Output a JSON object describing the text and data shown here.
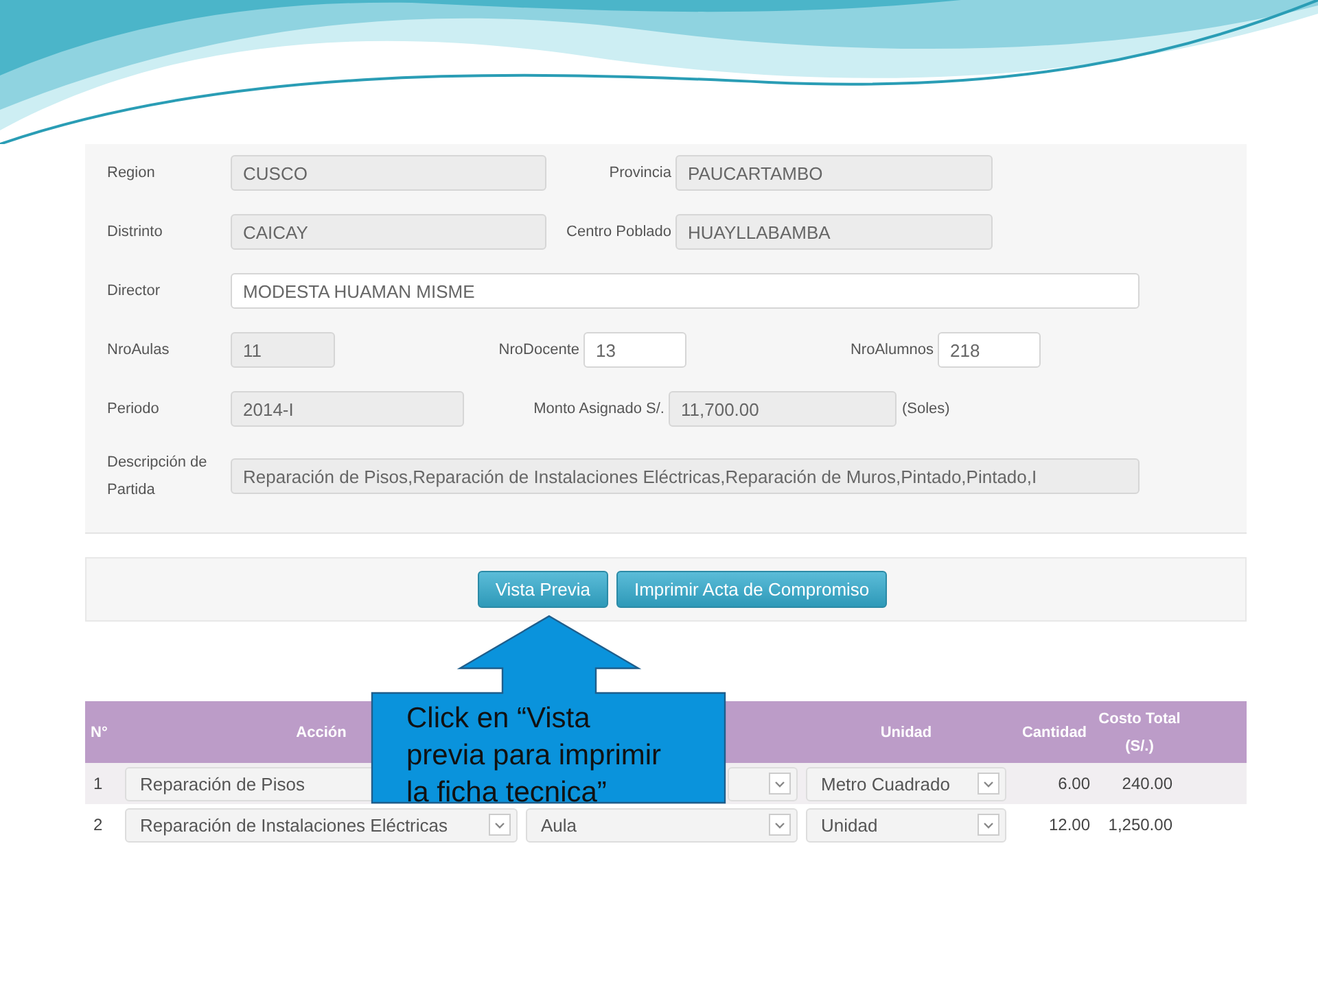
{
  "form": {
    "rows": [
      {
        "fields": [
          {
            "label": "Region",
            "value": "CUSCO",
            "editable": false
          },
          {
            "label": "Provincia",
            "value": "PAUCARTAMBO",
            "editable": false
          }
        ]
      },
      {
        "fields": [
          {
            "label": "Distrinto",
            "value": "CAICAY",
            "editable": false
          },
          {
            "label": "Centro Poblado",
            "value": "HUAYLLABAMBA",
            "editable": false
          }
        ]
      },
      {
        "fields": [
          {
            "label": "Director",
            "value": "MODESTA HUAMAN MISME",
            "editable": true
          }
        ]
      },
      {
        "fields": [
          {
            "label": "NroAulas",
            "value": "11",
            "editable": false
          },
          {
            "label": "NroDocente",
            "value": "13",
            "editable": true
          },
          {
            "label": "NroAlumnos",
            "value": "218",
            "editable": true
          }
        ]
      },
      {
        "fields": [
          {
            "label": "Periodo",
            "value": "2014-I",
            "editable": false
          },
          {
            "label": "Monto Asignado S/.",
            "value": "11,700.00",
            "editable": false,
            "suffix": "(Soles)"
          }
        ]
      },
      {
        "fields": [
          {
            "label": "Descripción de Partida",
            "value": "Reparación de Pisos,Reparación de Instalaciones Eléctricas,Reparación de Muros,Pintado,Pintado,I",
            "editable": false
          }
        ]
      }
    ]
  },
  "buttons": [
    "Vista Previa",
    "Imprimir Acta de Compromiso"
  ],
  "table": {
    "columns": [
      "N°",
      "Acción",
      "Unidad",
      "Cantidad",
      "Costo Total (S/.)"
    ],
    "rows": [
      {
        "n": "1",
        "accion": "Reparación de Pisos",
        "column_3": null,
        "unidad": "Metro Cuadrado",
        "cantidad": "6.00",
        "costo": "240.00"
      },
      {
        "n": "2",
        "accion": "Reparación de Instalaciones Eléctricas",
        "column_3": "Aula",
        "unidad": "Unidad",
        "cantidad": "12.00",
        "costo": "1,250.00"
      }
    ]
  },
  "callout": {
    "lines": [
      "Click en “Vista",
      "previa para imprimir",
      "la ficha tecnica”"
    ]
  }
}
